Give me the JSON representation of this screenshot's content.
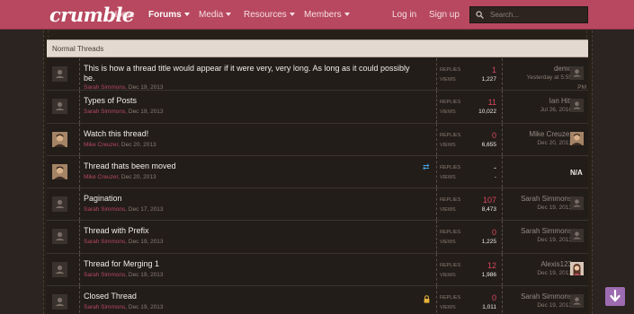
{
  "brand": {
    "logo": "crumble",
    "accent": "#b7485f"
  },
  "nav": {
    "home": "Home",
    "forums": "Forums",
    "media": "Media",
    "resources": "Resources",
    "members": "Members",
    "login": "Log in",
    "signup": "Sign up",
    "search_placeholder": "Search..."
  },
  "section": {
    "title": "Normal Threads"
  },
  "labels": {
    "replies": "REPLIES",
    "views": "VIEWS"
  },
  "threads": [
    {
      "title": "This is how a thread title would appear if it were very, very long. As long as it could possibly be.",
      "author": "Sarah Simmons",
      "date": "Dec 19, 2013",
      "replies": "1",
      "views": "1,227",
      "last_user": "demo",
      "last_date": "Yesterday at 5:55",
      "last_date_extra": "PM",
      "avatar": "default"
    },
    {
      "title": "Types of Posts",
      "author": "Sarah Simmons",
      "date": "Dec 19, 2013",
      "replies": "11",
      "views": "10,022",
      "last_user": "Ian Hitt",
      "last_date": "Jul 26, 2016",
      "avatar": "default"
    },
    {
      "title": "Watch this thread!",
      "author": "Mike Creuzer",
      "date": "Dec 20, 2013",
      "replies": "0",
      "views": "6,655",
      "last_user": "Mike Creuzer",
      "last_date": "Dec 20, 2013",
      "avatar": "photo"
    },
    {
      "title": "Thread thats been moved",
      "author": "Mike Creuzer",
      "date": "Dec 20, 2013",
      "replies": "-",
      "views": "-",
      "last_user": "N/A",
      "avatar": "photo",
      "moved": true
    },
    {
      "title": "Pagination",
      "author": "Sarah Simmons",
      "date": "Dec 17, 2013",
      "replies": "107",
      "views": "8,473",
      "last_user": "Sarah Simmons",
      "last_date": "Dec 19, 2013",
      "avatar": "default"
    },
    {
      "title": "Thread with Prefix",
      "author": "Sarah Simmons",
      "date": "Dec 19, 2013",
      "replies": "0",
      "views": "1,225",
      "last_user": "Sarah Simmons",
      "last_date": "Dec 19, 2013",
      "avatar": "default"
    },
    {
      "title": "Thread for Merging 1",
      "author": "Sarah Simmons",
      "date": "Dec 19, 2013",
      "replies": "12",
      "views": "1,986",
      "last_user": "Alexis123",
      "last_date": "Dec 19, 2013",
      "avatar": "default"
    },
    {
      "title": "Closed Thread",
      "author": "Sarah Simmons",
      "date": "Dec 19, 2013",
      "replies": "0",
      "views": "1,011",
      "last_user": "Sarah Simmons",
      "last_date": "Dec 19, 2013",
      "avatar": "default",
      "locked": true
    }
  ]
}
